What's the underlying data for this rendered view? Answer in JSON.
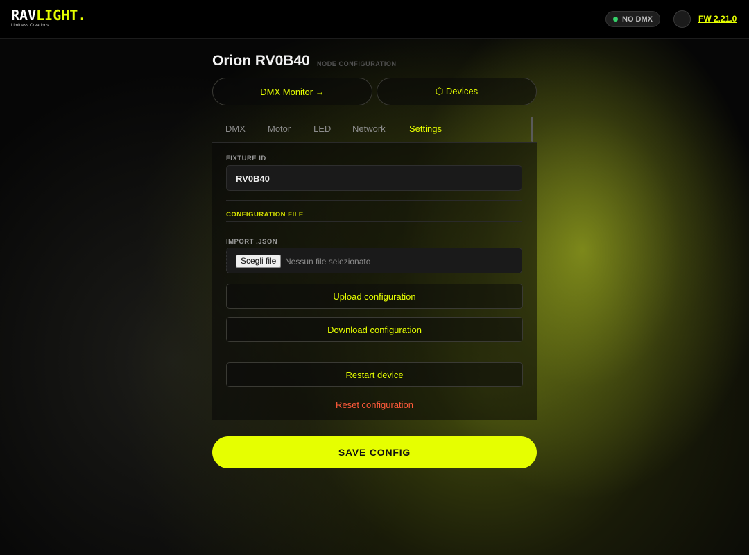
{
  "header": {
    "logo_rav": "RAV",
    "logo_light": "LIGHT.",
    "logo_tagline": "Limitless Creations",
    "dmx_status": "NO DMX",
    "info_icon": "i",
    "firmware": "FW 2.21.0"
  },
  "page": {
    "title": "Orion RV0B40",
    "subtitle": "NODE CONFIGURATION"
  },
  "top_buttons": {
    "monitor": "DMX Monitor →",
    "devices": "⬡ Devices"
  },
  "tabs": [
    {
      "label": "DMX"
    },
    {
      "label": "Motor"
    },
    {
      "label": "LED"
    },
    {
      "label": "Network"
    },
    {
      "label": "Settings",
      "active": true
    }
  ],
  "settings": {
    "fixture_id_label": "FIXTURE ID",
    "fixture_id_value": "RV0B40",
    "config_file_label": "CONFIGURATION FILE",
    "import_label": "IMPORT .JSON",
    "choose_file_label": "Scegli file",
    "no_file_text": "Nessun file selezionato",
    "upload_label": "Upload configuration",
    "download_label": "Download configuration",
    "restart_label": "Restart device",
    "reset_label": "Reset configuration",
    "save_label": "SAVE CONFIG"
  },
  "colors": {
    "accent": "#e6ff00",
    "danger": "#ff5a3a",
    "status_dot": "#36d26a",
    "background": "#060606"
  }
}
